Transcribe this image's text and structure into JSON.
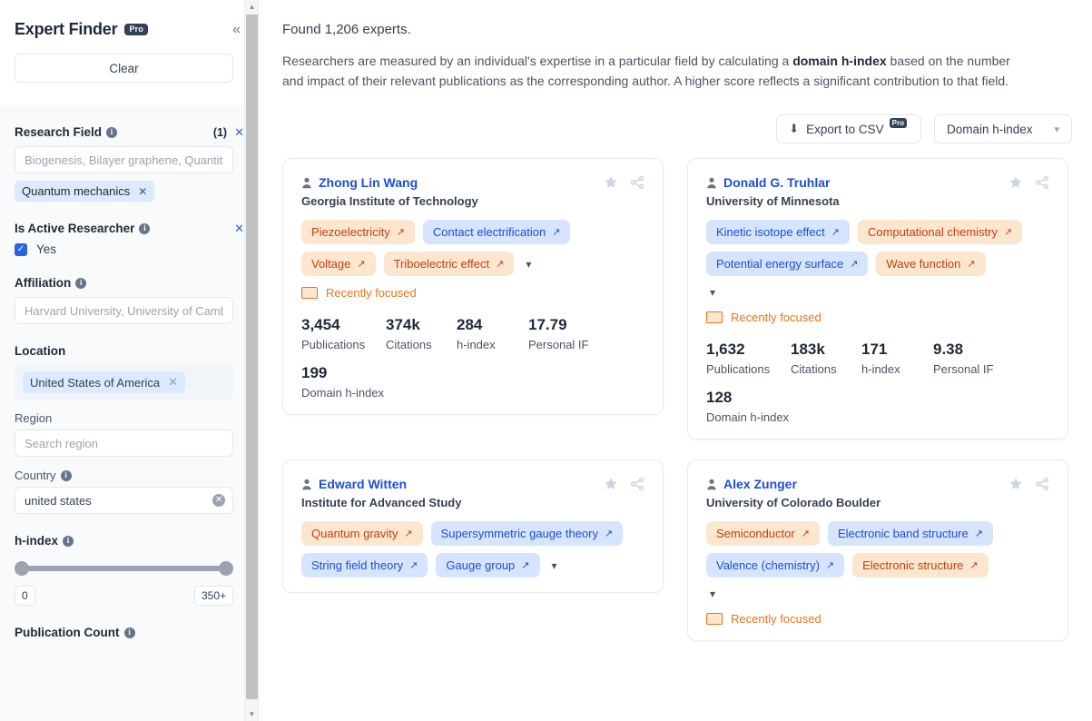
{
  "sidebar": {
    "title": "Expert Finder",
    "pro_badge": "Pro",
    "collapse_icon": "chevrons-left-icon",
    "clear_label": "Clear",
    "filters": {
      "research_field": {
        "label": "Research Field",
        "count": "(1)",
        "placeholder": "Biogenesis, Bilayer graphene, Quantita",
        "value": "",
        "chips": [
          "Quantum mechanics"
        ]
      },
      "is_active_researcher": {
        "label": "Is Active Researcher",
        "option_label": "Yes",
        "checked": true
      },
      "affiliation": {
        "label": "Affiliation",
        "placeholder": "Harvard University, University of Cambri",
        "value": ""
      },
      "location": {
        "label": "Location",
        "chips": [
          "United States of America"
        ],
        "region_label": "Region",
        "region_placeholder": "Search region",
        "region_value": "",
        "country_label": "Country",
        "country_value": "united states"
      },
      "h_index": {
        "label": "h-index",
        "min_value": "0",
        "max_value": "350+"
      },
      "publication_count": {
        "label": "Publication Count"
      }
    }
  },
  "main": {
    "found_text": "Found 1,206 experts.",
    "description_pre": "Researchers are measured by an individual's expertise in a particular field by calculating a ",
    "description_bold": "domain h-index",
    "description_post": " based on the number and impact of their relevant publications as the corresponding author. A higher score reflects a significant contribution to that field.",
    "toolbar": {
      "export_label": "Export to CSV",
      "export_pro_badge": "Pro",
      "sort_label": "Domain h-index"
    },
    "legend_label": "Recently focused",
    "stat_labels": {
      "publications": "Publications",
      "citations": "Citations",
      "h_index": "h-index",
      "personal_if": "Personal IF",
      "domain_h_index": "Domain h-index"
    },
    "experts": [
      {
        "name": "Zhong Lin Wang",
        "affiliation": "Georgia Institute of Technology",
        "tags": [
          {
            "label": "Piezoelectricity",
            "color": "orange"
          },
          {
            "label": "Contact electrification",
            "color": "blue"
          },
          {
            "label": "Voltage",
            "color": "orange"
          },
          {
            "label": "Triboelectric effect",
            "color": "orange"
          }
        ],
        "more_inline": true,
        "publications": "3,454",
        "citations": "374k",
        "h_index": "284",
        "personal_if": "17.79",
        "domain_h_index": "199"
      },
      {
        "name": "Donald G. Truhlar",
        "affiliation": "University of Minnesota",
        "tags": [
          {
            "label": "Kinetic isotope effect",
            "color": "blue"
          },
          {
            "label": "Computational chemistry",
            "color": "orange"
          },
          {
            "label": "Potential energy surface",
            "color": "blue"
          },
          {
            "label": "Wave function",
            "color": "orange"
          }
        ],
        "more_inline": false,
        "publications": "1,632",
        "citations": "183k",
        "h_index": "171",
        "personal_if": "9.38",
        "domain_h_index": "128"
      },
      {
        "name": "Edward Witten",
        "affiliation": "Institute for Advanced Study",
        "tags": [
          {
            "label": "Quantum gravity",
            "color": "orange"
          },
          {
            "label": "Supersymmetric gauge theory",
            "color": "blue"
          },
          {
            "label": "String field theory",
            "color": "blue"
          },
          {
            "label": "Gauge group",
            "color": "blue"
          }
        ],
        "more_inline": true,
        "publications": "",
        "citations": "",
        "h_index": "",
        "personal_if": "",
        "domain_h_index": ""
      },
      {
        "name": "Alex Zunger",
        "affiliation": "University of Colorado Boulder",
        "tags": [
          {
            "label": "Semiconductor",
            "color": "orange"
          },
          {
            "label": "Electronic band structure",
            "color": "blue"
          },
          {
            "label": "Valence (chemistry)",
            "color": "blue"
          },
          {
            "label": "Electronic structure",
            "color": "orange"
          }
        ],
        "more_inline": false,
        "publications": "",
        "citations": "",
        "h_index": "",
        "personal_if": "",
        "domain_h_index": ""
      }
    ]
  },
  "colors": {
    "accent_blue": "#2563eb",
    "link_blue": "#1d4ed8",
    "tag_orange_bg": "#fde6cf",
    "tag_orange_fg": "#c2410c",
    "tag_blue_bg": "#d6e4fd",
    "legend_orange": "#ea7317",
    "sidebar_bg": "#f8fafc"
  }
}
